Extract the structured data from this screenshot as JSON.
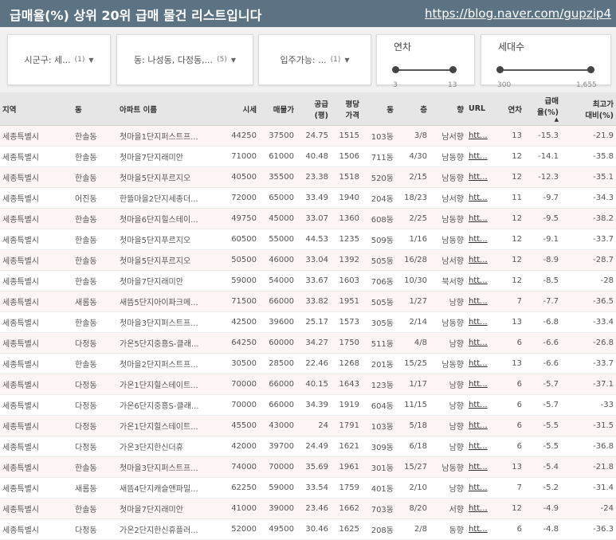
{
  "header": {
    "title": "급매율(%) 상위 20위 급매 물건 리스트입니다",
    "link": "https://blog.naver.com/gupzip4"
  },
  "filters": {
    "sigungu": {
      "label": "시군구: 세...",
      "count": "(1)"
    },
    "dong": {
      "label": "동: 나성동, 다정동,...",
      "count": "(5)"
    },
    "movein": {
      "label": "입주가능: ...",
      "count": "(1)"
    },
    "year": {
      "label": "연차",
      "min": "3",
      "max": "13"
    },
    "households": {
      "label": "세대수",
      "min": "300",
      "max": "1,655"
    }
  },
  "table": {
    "headers": [
      "지역",
      "동",
      "아파트 이름",
      "시세",
      "매물가",
      "공급\n(평)",
      "평당\n가격",
      "동",
      "층",
      "향",
      "URL",
      "연차",
      "급매\n율(%)",
      "최고가\n대비(%)"
    ],
    "sort_indicator": "▲",
    "rows": [
      [
        "세종특별시",
        "한솔동",
        "첫마을1단지퍼스트프...",
        "44250",
        "37500",
        "24.75",
        "1515",
        "103동",
        "3/8",
        "남서향",
        "htt...",
        "13",
        "-15.3",
        "-21.9"
      ],
      [
        "세종특별시",
        "한솔동",
        "첫마을7단지래미안",
        "71000",
        "61000",
        "40.48",
        "1506",
        "711동",
        "4/30",
        "남동향",
        "htt...",
        "12",
        "-14.1",
        "-35.8"
      ],
      [
        "세종특별시",
        "한솔동",
        "첫마을5단지푸르지오",
        "40500",
        "35500",
        "23.38",
        "1518",
        "520동",
        "2/15",
        "남동향",
        "htt...",
        "12",
        "-12.3",
        "-35.1"
      ],
      [
        "세종특별시",
        "어진동",
        "한뜰마을2단지세종더...",
        "72000",
        "65000",
        "33.49",
        "1940",
        "204동",
        "18/23",
        "남서향",
        "htt...",
        "11",
        "-9.7",
        "-34.3"
      ],
      [
        "세종특별시",
        "한솔동",
        "첫마을6단지힐스테이...",
        "49750",
        "45000",
        "33.07",
        "1360",
        "608동",
        "2/25",
        "남동향",
        "htt...",
        "12",
        "-9.5",
        "-38.2"
      ],
      [
        "세종특별시",
        "한솔동",
        "첫마을5단지푸르지오",
        "60500",
        "55000",
        "44.53",
        "1235",
        "509동",
        "1/16",
        "남동향",
        "htt...",
        "12",
        "-9.1",
        "-33.7"
      ],
      [
        "세종특별시",
        "한솔동",
        "첫마을5단지푸르지오",
        "50500",
        "46000",
        "33.04",
        "1392",
        "505동",
        "16/28",
        "남서향",
        "htt...",
        "12",
        "-8.9",
        "-28.7"
      ],
      [
        "세종특별시",
        "한솔동",
        "첫마을7단지래미안",
        "59000",
        "54000",
        "33.67",
        "1603",
        "706동",
        "10/30",
        "북서향",
        "htt...",
        "12",
        "-8.5",
        "-28"
      ],
      [
        "세종특별시",
        "새롬동",
        "새뜸5단지아이파크메...",
        "71500",
        "66000",
        "33.82",
        "1951",
        "505동",
        "1/27",
        "남향",
        "htt...",
        "7",
        "-7.7",
        "-36.5"
      ],
      [
        "세종특별시",
        "한솔동",
        "첫마을3단지퍼스트프...",
        "42500",
        "39600",
        "25.17",
        "1573",
        "305동",
        "2/14",
        "남동향",
        "htt...",
        "13",
        "-6.8",
        "-33.4"
      ],
      [
        "세종특별시",
        "다정동",
        "가온5단지중흥S-클래...",
        "64250",
        "60000",
        "34.27",
        "1750",
        "511동",
        "4/8",
        "남향",
        "htt...",
        "6",
        "-6.6",
        "-26.8"
      ],
      [
        "세종특별시",
        "한솔동",
        "첫마을2단지퍼스트프...",
        "30500",
        "28500",
        "22.46",
        "1268",
        "201동",
        "15/25",
        "남동향",
        "htt...",
        "13",
        "-6.6",
        "-33.7"
      ],
      [
        "세종특별시",
        "다정동",
        "가온1단지힐스테이트...",
        "70000",
        "66000",
        "40.15",
        "1643",
        "123동",
        "1/17",
        "남향",
        "htt...",
        "6",
        "-5.7",
        "-37.1"
      ],
      [
        "세종특별시",
        "다정동",
        "가온6단지중흥S-클래...",
        "70000",
        "66000",
        "34.39",
        "1919",
        "604동",
        "11/15",
        "남향",
        "htt...",
        "6",
        "-5.7",
        "-33"
      ],
      [
        "세종특별시",
        "다정동",
        "가온1단지힐스테이트...",
        "45500",
        "43000",
        "24",
        "1791",
        "103동",
        "5/18",
        "남향",
        "htt...",
        "6",
        "-5.5",
        "-31.5"
      ],
      [
        "세종특별시",
        "다정동",
        "가온3단지한신더휴",
        "42000",
        "39700",
        "24.49",
        "1621",
        "309동",
        "6/18",
        "남향",
        "htt...",
        "6",
        "-5.5",
        "-36.8"
      ],
      [
        "세종특별시",
        "한솔동",
        "첫마을3단지퍼스트프...",
        "74000",
        "70000",
        "35.69",
        "1961",
        "301동",
        "15/27",
        "남동향",
        "htt...",
        "13",
        "-5.4",
        "-21.8"
      ],
      [
        "세종특별시",
        "새롬동",
        "새뜸4단지캐슬앤파밀...",
        "62250",
        "59000",
        "33.54",
        "1759",
        "401동",
        "2/10",
        "남향",
        "htt...",
        "7",
        "-5.2",
        "-31.4"
      ],
      [
        "세종특별시",
        "한솔동",
        "첫마을7단지래미안",
        "41000",
        "39000",
        "23.46",
        "1662",
        "703동",
        "8/20",
        "서향",
        "htt...",
        "12",
        "-4.9",
        "-24"
      ],
      [
        "세종특별시",
        "다정동",
        "가온2단지한신휴플러...",
        "52000",
        "49500",
        "30.46",
        "1625",
        "208동",
        "2/8",
        "동향",
        "htt...",
        "6",
        "-4.8",
        "-36.3"
      ]
    ]
  }
}
